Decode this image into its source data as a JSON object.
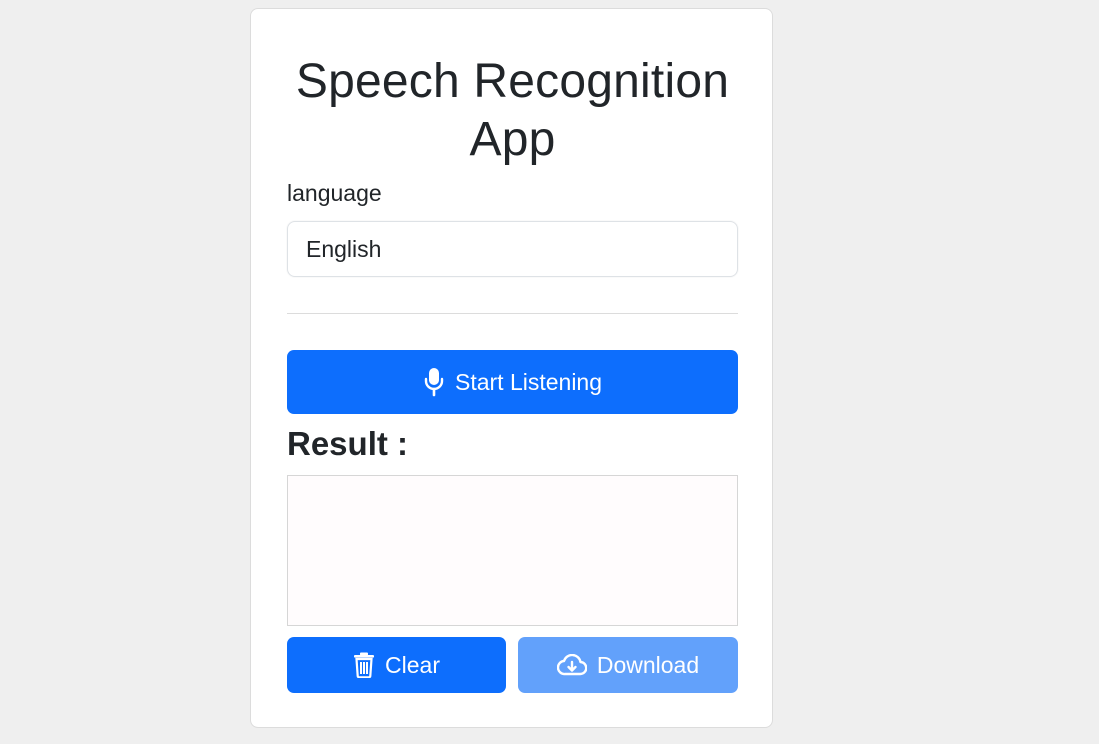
{
  "app": {
    "title": "Speech Recognition App"
  },
  "language": {
    "label": "language",
    "selected": "English"
  },
  "actions": {
    "start_label": "Start Listening",
    "start_icon": "microphone-icon",
    "clear_label": "Clear",
    "clear_icon": "trash-icon",
    "download_label": "Download",
    "download_icon": "cloud-download-icon"
  },
  "result": {
    "heading": "Result :",
    "text": ""
  },
  "colors": {
    "primary": "#0d6efd",
    "primary_disabled": "#62a1fb",
    "background": "#efefef"
  }
}
